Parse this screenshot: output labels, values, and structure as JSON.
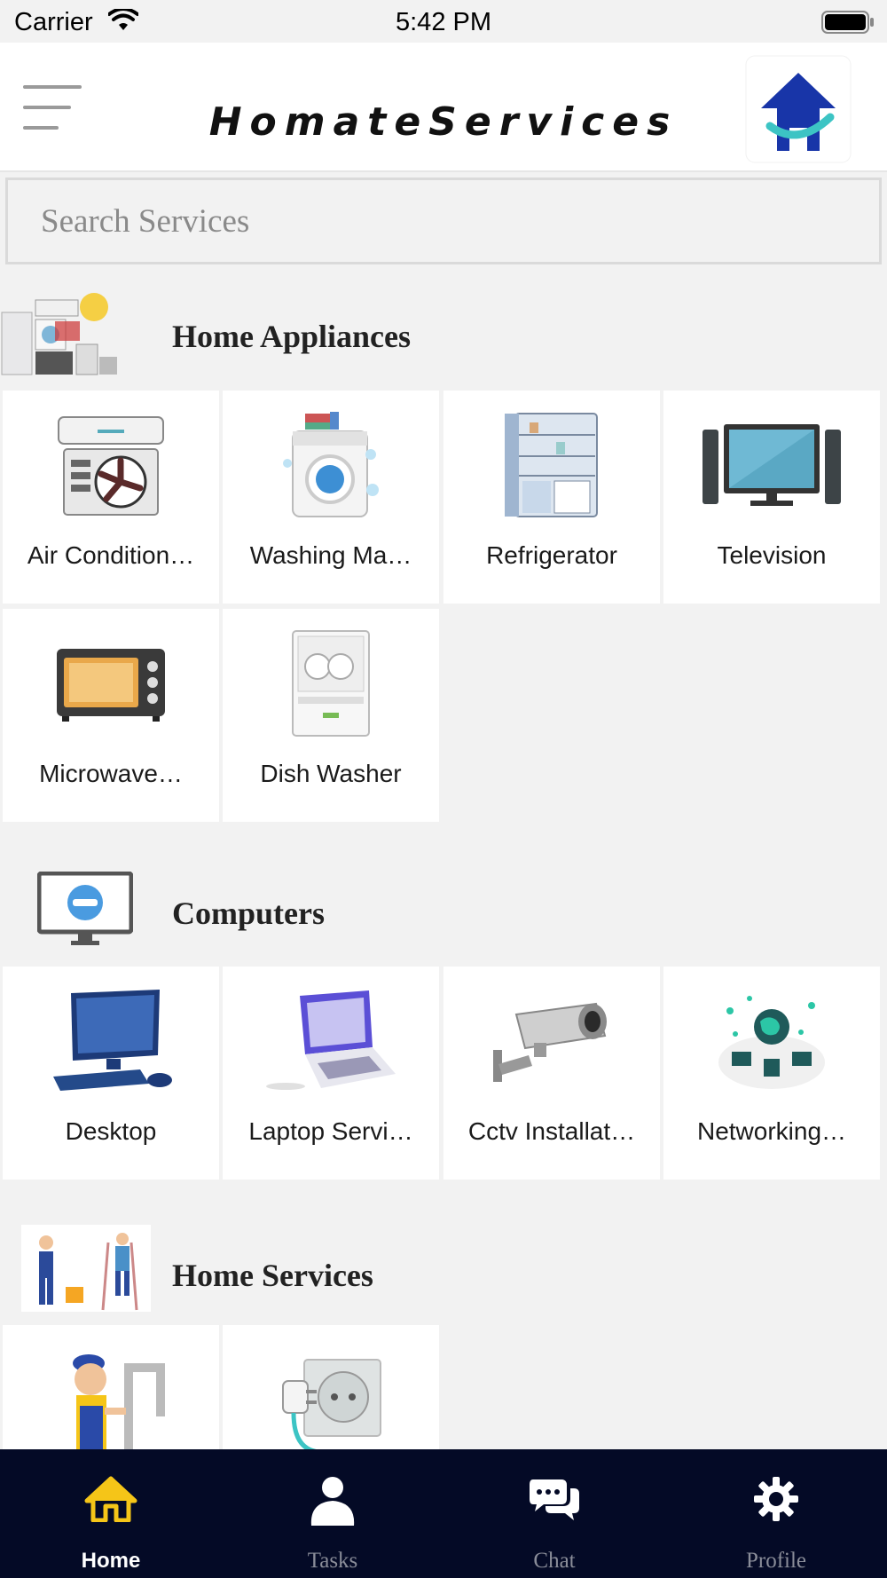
{
  "status_bar": {
    "carrier": "Carrier",
    "time": "5:42 PM"
  },
  "header": {
    "title": "HomateServices",
    "menu_icon": "hamburger-menu-icon",
    "logo_icon": "house-logo"
  },
  "search": {
    "placeholder": "Search Services",
    "value": ""
  },
  "sections": [
    {
      "title": "Home Appliances",
      "icon": "appliances-collage-icon",
      "items": [
        {
          "label": "Air Condition…",
          "icon": "air-conditioner-icon"
        },
        {
          "label": "Washing Ma…",
          "icon": "washing-machine-icon"
        },
        {
          "label": "Refrigerator",
          "icon": "refrigerator-icon"
        },
        {
          "label": "Television",
          "icon": "television-icon"
        },
        {
          "label": "Microwave…",
          "icon": "microwave-icon"
        },
        {
          "label": "Dish Washer",
          "icon": "dishwasher-icon"
        }
      ]
    },
    {
      "title": "Computers",
      "icon": "monitor-icon",
      "items": [
        {
          "label": "Desktop",
          "icon": "desktop-icon"
        },
        {
          "label": "Laptop Servi…",
          "icon": "laptop-icon"
        },
        {
          "label": "Cctv Installat…",
          "icon": "cctv-camera-icon"
        },
        {
          "label": "Networking…",
          "icon": "networking-icon"
        }
      ]
    },
    {
      "title": "Home Services",
      "icon": "workers-icon",
      "items": [
        {
          "label": "",
          "icon": "plumber-icon"
        },
        {
          "label": "",
          "icon": "electrical-socket-icon"
        }
      ]
    }
  ],
  "tabs": [
    {
      "label": "Home",
      "icon": "home-icon",
      "active": true
    },
    {
      "label": "Tasks",
      "icon": "person-icon",
      "active": false
    },
    {
      "label": "Chat",
      "icon": "chat-bubbles-icon",
      "active": false
    },
    {
      "label": "Profile",
      "icon": "gear-icon",
      "active": false
    }
  ],
  "colors": {
    "tab_bar_bg": "#040a26",
    "accent_home": "#f5c518",
    "logo_blue": "#1835a8",
    "logo_teal": "#3cc4c4"
  }
}
